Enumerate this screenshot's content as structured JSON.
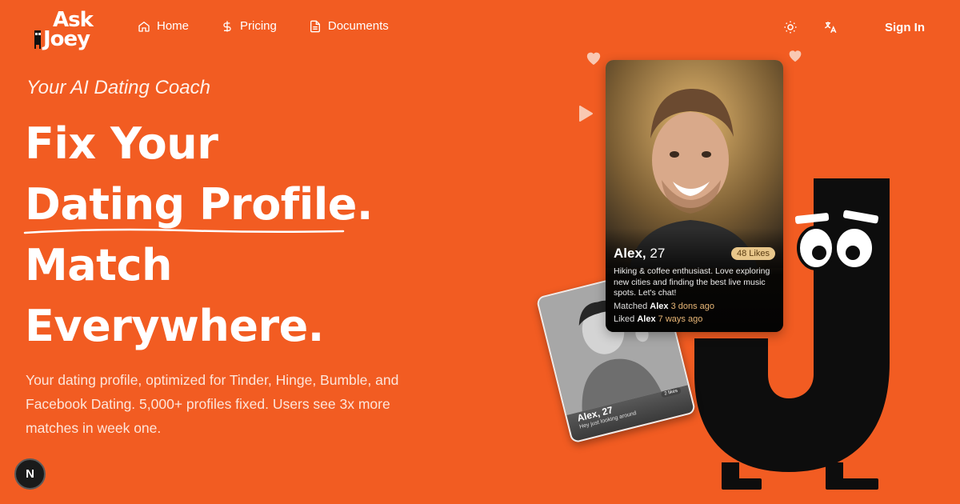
{
  "brand": {
    "logo_line1": "Ask",
    "logo_line2": "Joey"
  },
  "nav": {
    "items": [
      {
        "label": "Home",
        "icon": "home-icon"
      },
      {
        "label": "Pricing",
        "icon": "dollar-icon"
      },
      {
        "label": "Documents",
        "icon": "document-icon"
      }
    ],
    "theme_icon": "sun-icon",
    "language_icon": "translate-icon",
    "signin_label": "Sign In"
  },
  "hero": {
    "tagline": "Your AI Dating Coach",
    "headline_lines": [
      "Fix Your",
      "Dating Profile.",
      "Match",
      "Everywhere."
    ],
    "description": "Your dating profile, optimized for Tinder, Hinge, Bumble, and Facebook Dating. 5,000+ profiles fixed. Users see 3x more matches in week one."
  },
  "profile_card": {
    "name": "Alex,",
    "age": "27",
    "likes": "48 Likes",
    "bio": "Hiking & coffee enthusiast. Love exploring new cities and finding the best live music spots. Let's chat!",
    "activity": [
      {
        "prefix": "Matched",
        "who": "Alex",
        "time": "3 dons ago"
      },
      {
        "prefix": "Liked",
        "who": "Alex",
        "time": "7 ways ago"
      }
    ]
  },
  "small_card": {
    "name": "Alex, 27",
    "sub": "Hey just looking around",
    "likes": "2 likes"
  },
  "badge": {
    "label": "N"
  },
  "colors": {
    "background": "#f25c22",
    "mascot": "#0d0d0d",
    "text": "#ffffff"
  }
}
